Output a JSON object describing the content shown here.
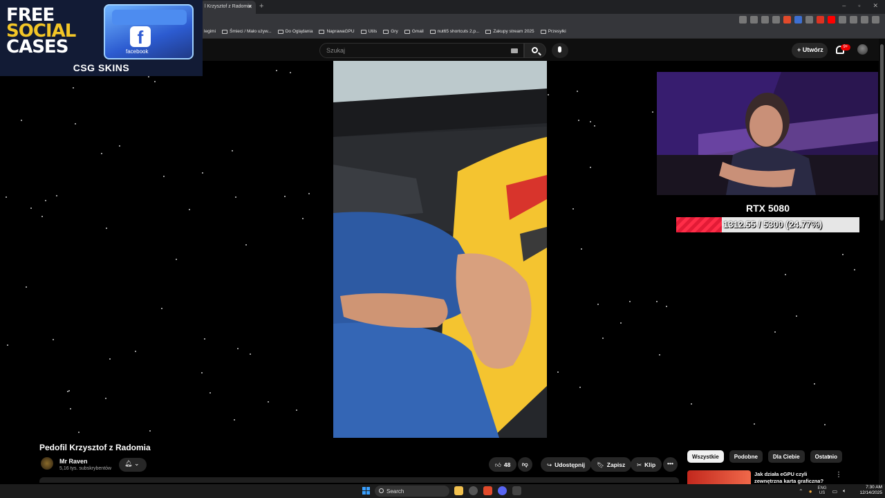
{
  "browser": {
    "active_tab_title": "l Krzysztof z Radomia",
    "bookmarks": [
      "s legimi",
      "Śmieci / Mało używ...",
      "Do Oglądania",
      "NaprawaGPU",
      "Utils",
      "Gry",
      "Gmail",
      "nut65 shortcuts 2.p...",
      "Zakupy stream 2025",
      "Przesyłki"
    ]
  },
  "youtube": {
    "search_placeholder": "Szukaj",
    "create_label": "Utwórz",
    "notification_count": "9+"
  },
  "ad": {
    "line1": "FREE",
    "line2": "SOCIAL",
    "line3": "CASES",
    "box_label": "facebook",
    "brand": "CSG SKINS",
    "colors": {
      "accent": "#f3c627",
      "background": "#121b35"
    }
  },
  "stream_overlay": {
    "title": "RTX 5080",
    "progress_text": "1312.55 / 5300 (24.77%)",
    "progress_fraction": 0.2477,
    "fill_color": "#ff2d48"
  },
  "video": {
    "title": "Pedofil Krzysztof z Radomia",
    "channel_name": "Mr Raven",
    "subscribers": "5,16 tys. subskrybentów",
    "likes": "48",
    "share_label": "Udostępnij",
    "save_label": "Zapisz",
    "clip_label": "Klip"
  },
  "recommendations": {
    "chips": [
      "Wszystkie",
      "Podobne",
      "Dla Ciebie",
      "Ostatnio"
    ],
    "first_title": "Jak działa eGPU czyli zewnętrzna karta graficzna?"
  },
  "taskbar": {
    "search_label": "Search",
    "lang_top": "ENG",
    "lang_bottom": "US",
    "time": "7:30 AM",
    "date": "12/14/2025"
  }
}
